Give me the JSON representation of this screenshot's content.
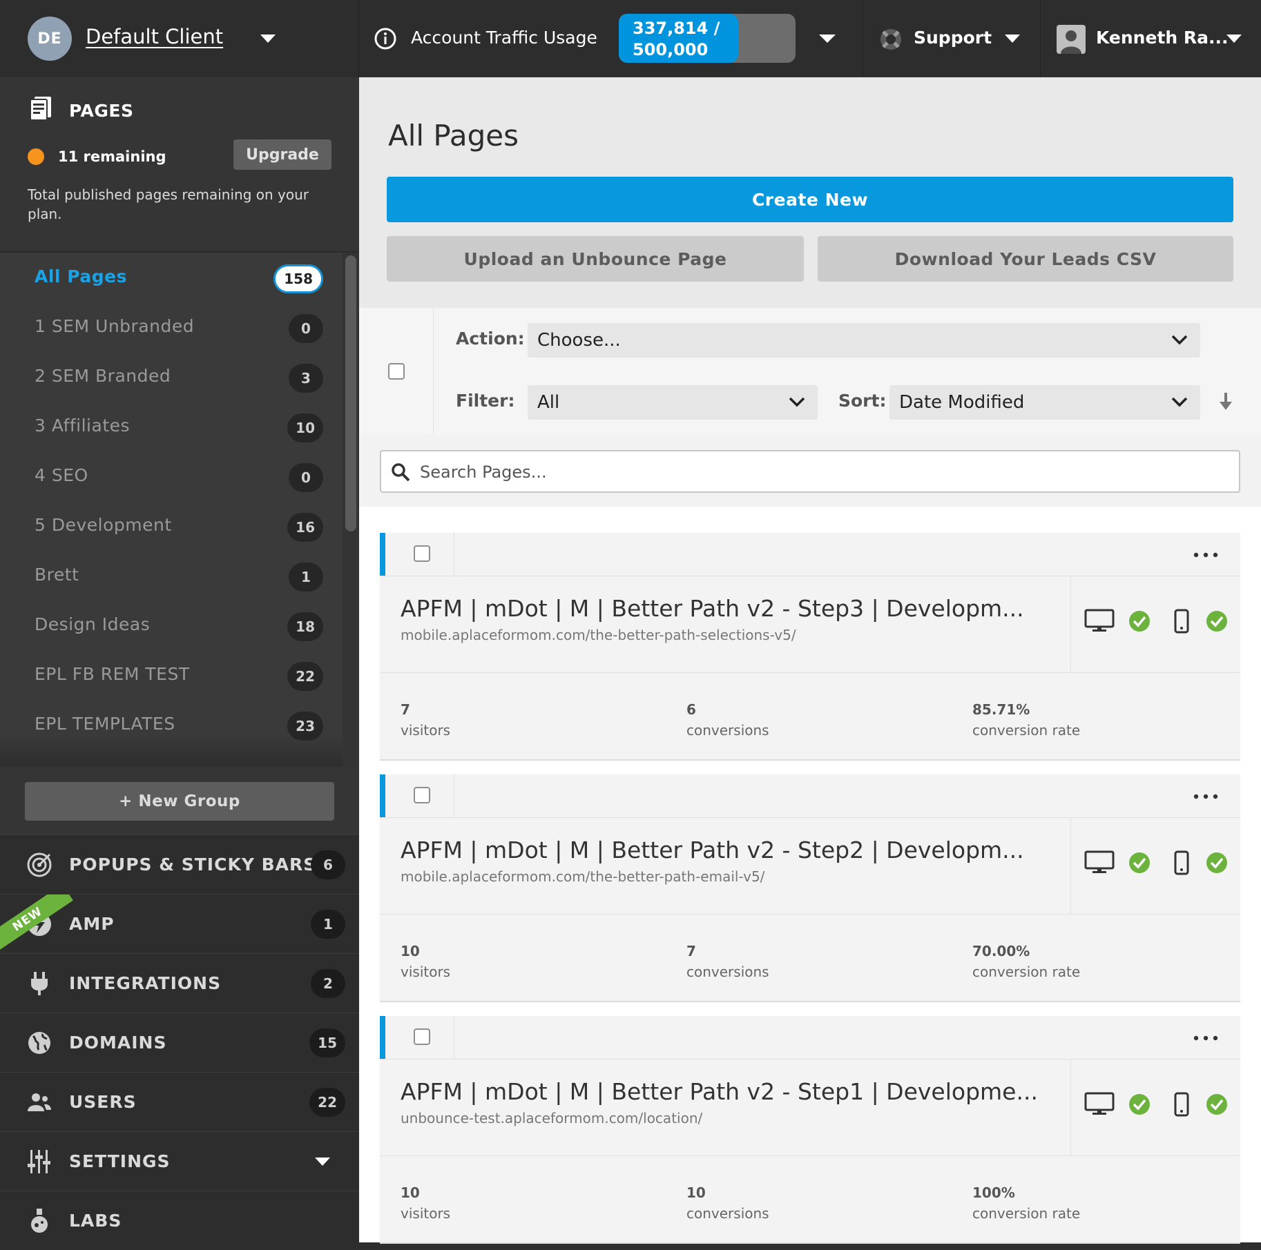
{
  "header": {
    "client": {
      "initials": "DE",
      "name": "Default Client"
    },
    "traffic": {
      "label": "Account Traffic Usage",
      "used": "337,814 /",
      "limit": "500,000",
      "fraction": 0.6756
    },
    "support": {
      "label": "Support"
    },
    "user": {
      "name": "Kenneth Ra..."
    }
  },
  "sidebar": {
    "pages": {
      "title": "PAGES",
      "remaining": "11 remaining",
      "upgrade_label": "Upgrade",
      "description": "Total published pages remaining on your plan."
    },
    "groups": [
      {
        "label": "All Pages",
        "count": "158"
      },
      {
        "label": "1 SEM Unbranded",
        "count": "0"
      },
      {
        "label": "2 SEM Branded",
        "count": "3"
      },
      {
        "label": "3 Affiliates",
        "count": "10"
      },
      {
        "label": "4 SEO",
        "count": "0"
      },
      {
        "label": "5 Development",
        "count": "16"
      },
      {
        "label": "Brett",
        "count": "1"
      },
      {
        "label": "Design Ideas",
        "count": "18"
      },
      {
        "label": "EPL FB REM TEST",
        "count": "22"
      },
      {
        "label": "EPL TEMPLATES",
        "count": "23"
      }
    ],
    "new_group_label": "+ New Group",
    "nav": [
      {
        "label": "POPUPS & STICKY BARS",
        "count": "6",
        "icon": "target-icon"
      },
      {
        "label": "AMP",
        "count": "1",
        "icon": "bolt-icon",
        "badge": "NEW"
      },
      {
        "label": "INTEGRATIONS",
        "count": "2",
        "icon": "plug-icon"
      },
      {
        "label": "DOMAINS",
        "count": "15",
        "icon": "globe-icon"
      },
      {
        "label": "USERS",
        "count": "22",
        "icon": "users-icon"
      },
      {
        "label": "SETTINGS",
        "count": "",
        "icon": "sliders-icon"
      },
      {
        "label": "LABS",
        "count": "",
        "icon": "flask-icon"
      }
    ]
  },
  "main": {
    "title": "All Pages",
    "create_label": "Create New",
    "upload_label": "Upload an Unbounce Page",
    "download_label": "Download Your Leads CSV",
    "action_label": "Action:",
    "action_value": "Choose...",
    "filter_label": "Filter:",
    "filter_value": "All",
    "sort_label": "Sort:",
    "sort_value": "Date Modified",
    "search_placeholder": "Search Pages...",
    "pages": [
      {
        "name": "APFM | mDot | M | Better Path v2 - Step3 | Developm...",
        "url": "mobile.aplaceformom.com/the-better-path-selections-v5/",
        "visitors": "7",
        "visitors_label": "visitors",
        "conversions": "6",
        "conversions_label": "conversions",
        "rate": "85.71%",
        "rate_label": "conversion rate"
      },
      {
        "name": "APFM | mDot | M | Better Path v2 - Step2 | Developm...",
        "url": "mobile.aplaceformom.com/the-better-path-email-v5/",
        "visitors": "10",
        "visitors_label": "visitors",
        "conversions": "7",
        "conversions_label": "conversions",
        "rate": "70.00%",
        "rate_label": "conversion rate"
      },
      {
        "name": "APFM | mDot | M | Better Path v2 - Step1 | Developme...",
        "url": "unbounce-test.aplaceformom.com/location/",
        "visitors": "10",
        "visitors_label": "visitors",
        "conversions": "10",
        "conversions_label": "conversions",
        "rate": "100%",
        "rate_label": "conversion rate"
      }
    ]
  },
  "colors": {
    "accent": "#0898dd",
    "orange": "#f7941d",
    "success": "#6cb33e",
    "sidebar": "#2d2d2d"
  }
}
